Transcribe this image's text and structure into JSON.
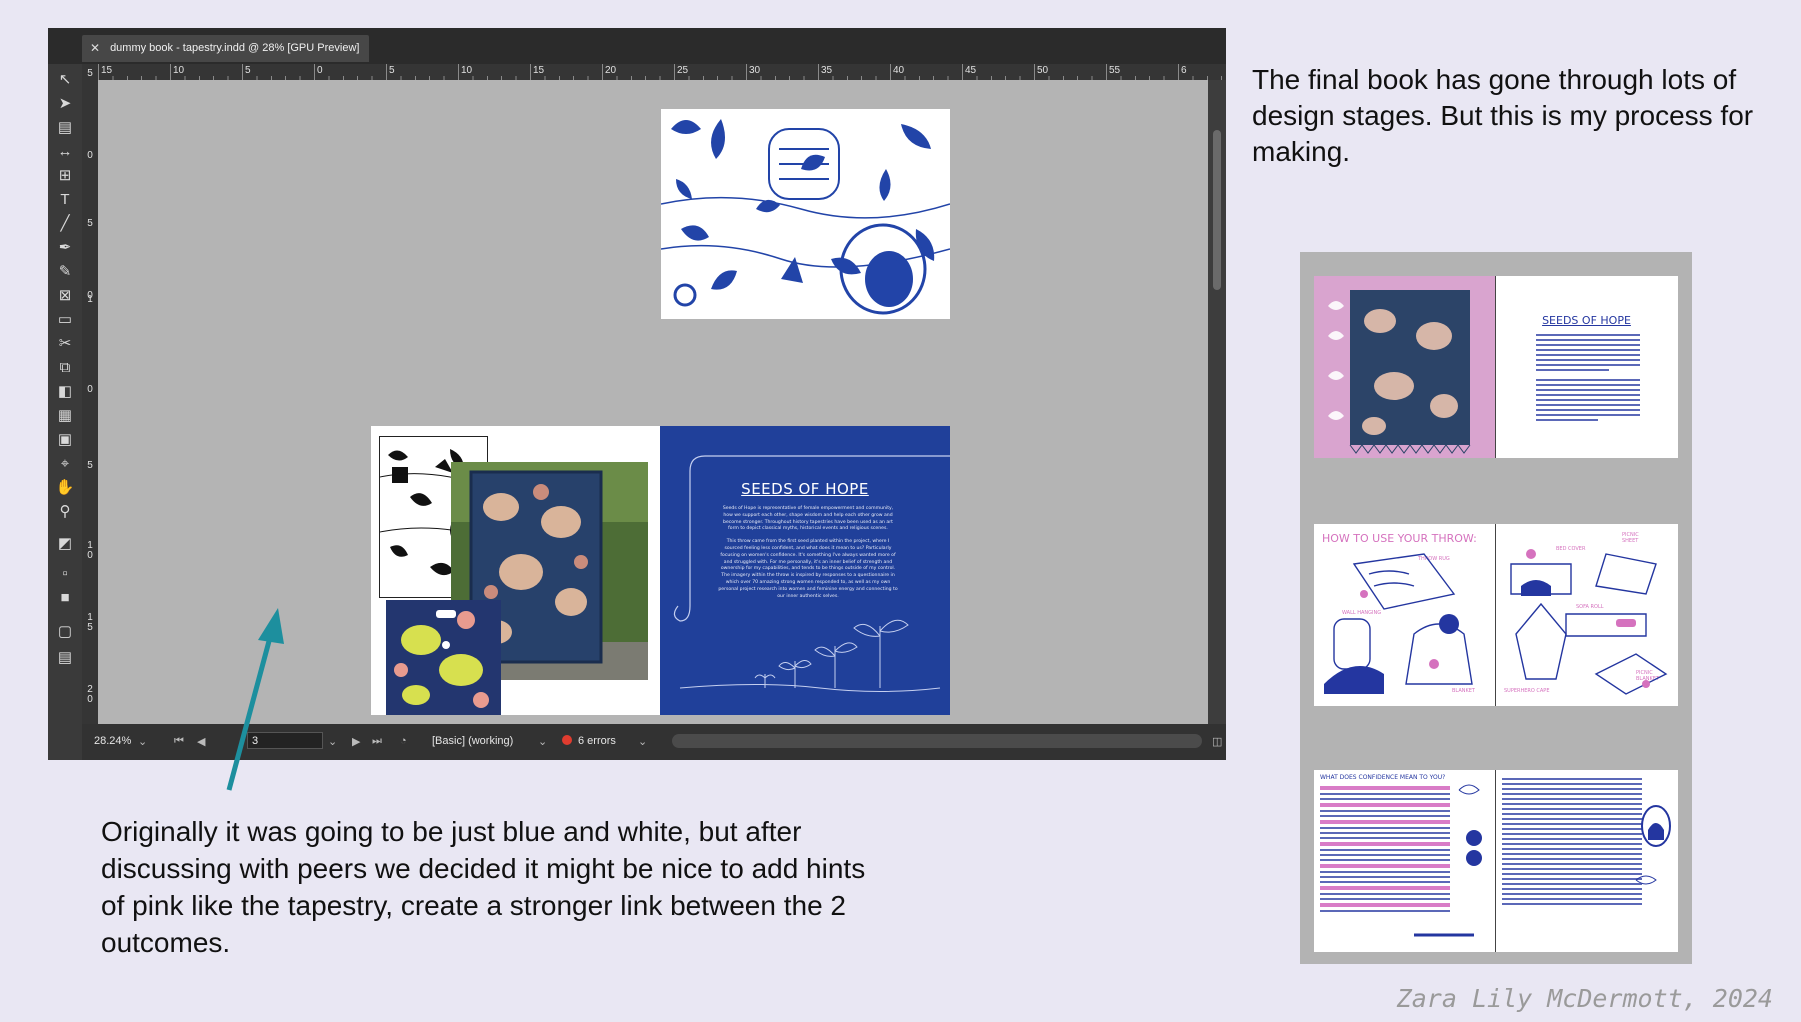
{
  "window": {
    "doc_tab": "dummy book - tapestry.indd @ 28% [GPU Preview]"
  },
  "ruler": {
    "h_labels": [
      "15",
      "10",
      "5",
      "0",
      "5",
      "10",
      "15",
      "20",
      "25",
      "30",
      "35",
      "40",
      "45",
      "50",
      "55",
      "6"
    ],
    "v_labels": [
      "5",
      "0",
      "5",
      "0",
      "1",
      "0",
      "5",
      "1",
      "0",
      "1",
      "5",
      "2",
      "0",
      "0",
      "5",
      "1",
      "0",
      "1",
      "5",
      "2",
      "0"
    ]
  },
  "status": {
    "zoom": "28.24%",
    "page": "3",
    "preflight_profile": "[Basic] (working)",
    "errors": "6 errors"
  },
  "spread": {
    "title": "SEEDS OF HOPE",
    "body_p1": "Seeds of Hope is representative of female empowerment and community, how we support each other, shape wisdom and help each other grow and become stronger. Throughout history tapestries have been used as an art form to depict classical myths, historical events and religious scenes.",
    "body_p2": "This throw came from the first seed planted within the project, where I sourced feeling less confident, and what does it mean to us? Particularly focusing on women's confidence. It's something I've always wanted more of and struggled with. For me personally, it's an inner belief of strength and ownership for my capabilities, and tends to be things outside of my control. The imagery within the throw is inspired by responses to a questionnaire in which over 70 amazing strong women responded to, as well as my own personal project research into women and feminine energy and connecting to our inner authentic selves."
  },
  "captions": {
    "right": "The final book has gone through lots of design stages. But this is my process for making.",
    "bottom": "Originally it was going to be just blue and white, but after discussing with peers we decided it might be nice to add hints of pink like the tapestry, create a stronger link between the 2 outcomes.",
    "credit": "Zara Lily McDermott, 2024"
  },
  "thumbnails": {
    "spread1_title": "SEEDS OF HOPE",
    "spread2_title": "HOW TO USE YOUR THROW:",
    "spread2_labels": [
      "THROW RUG",
      "WALL HANGING",
      "BLANKET",
      "BED COVER",
      "PICNIC SHEET",
      "SOFA ROLL",
      "SUPERHERO CAPE",
      "PICNIC BLANKET"
    ],
    "spread3_title": "WHAT DOES CONFIDENCE MEAN TO YOU?"
  },
  "colors": {
    "accent_blue": "#20409a",
    "pink": "#d9a4cf",
    "arrow_teal": "#1d8f9e",
    "error_red": "#e03c2f"
  }
}
